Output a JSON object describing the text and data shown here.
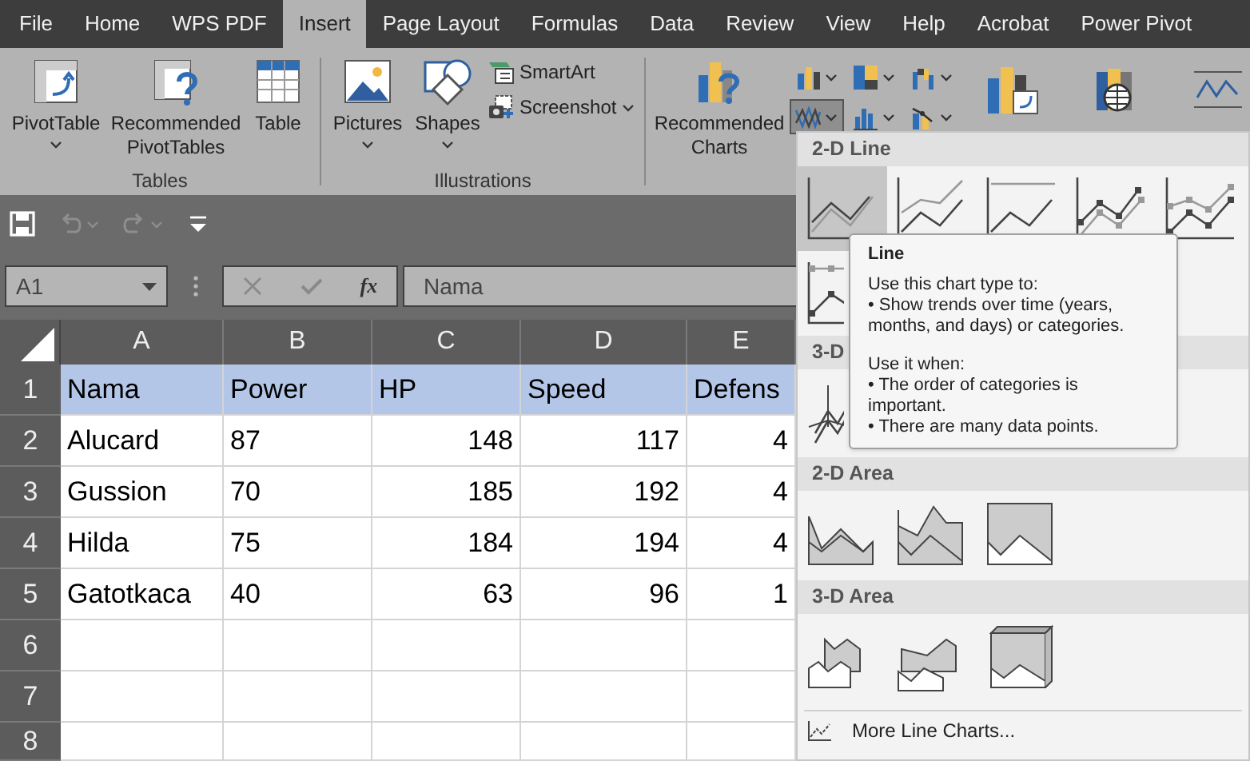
{
  "tabs": [
    {
      "label": "File",
      "selected": false
    },
    {
      "label": "Home",
      "selected": false
    },
    {
      "label": "WPS PDF",
      "selected": false
    },
    {
      "label": "Insert",
      "selected": true
    },
    {
      "label": "Page Layout",
      "selected": false
    },
    {
      "label": "Formulas",
      "selected": false
    },
    {
      "label": "Data",
      "selected": false
    },
    {
      "label": "Review",
      "selected": false
    },
    {
      "label": "View",
      "selected": false
    },
    {
      "label": "Help",
      "selected": false
    },
    {
      "label": "Acrobat",
      "selected": false
    },
    {
      "label": "Power Pivot",
      "selected": false
    }
  ],
  "ribbon": {
    "tables": {
      "label": "Tables",
      "buttons": [
        {
          "label": "PivotTable",
          "dropdown": true
        },
        {
          "label": "Recommended PivotTables",
          "dropdown": false
        },
        {
          "label": "Table",
          "dropdown": false
        }
      ]
    },
    "illustrations": {
      "label": "Illustrations",
      "large_buttons": [
        {
          "label": "Pictures",
          "dropdown": true
        },
        {
          "label": "Shapes",
          "dropdown": true
        }
      ],
      "small_buttons": [
        {
          "label": "SmartArt",
          "dropdown": false
        },
        {
          "label": "Screenshot",
          "dropdown": true
        }
      ]
    },
    "charts": {
      "recommended": {
        "label": "Recommended Charts"
      },
      "chart_types": [
        {
          "selected": false
        },
        {
          "selected": false
        },
        {
          "selected": false
        },
        {
          "selected": true
        },
        {
          "selected": false
        },
        {
          "selected": false
        }
      ]
    }
  },
  "quick_access": [
    {
      "kind": "save",
      "disabled": false
    },
    {
      "kind": "undo",
      "disabled": true
    },
    {
      "kind": "redo",
      "disabled": true
    },
    {
      "kind": "customize",
      "disabled": false
    }
  ],
  "name_box": {
    "value": "A1"
  },
  "formula_buttons": [
    {
      "kind": "cancel",
      "disabled": true
    },
    {
      "kind": "enter",
      "disabled": true
    },
    {
      "kind": "function",
      "disabled": false,
      "label": "fx"
    }
  ],
  "formula_bar": {
    "value": "Nama"
  },
  "sheet": {
    "columns": [
      {
        "label": "A",
        "align_right": false
      },
      {
        "label": "B",
        "align_right": false
      },
      {
        "label": "C",
        "align_right": true
      },
      {
        "label": "D",
        "align_right": true
      },
      {
        "label": "E",
        "align_right": true
      }
    ],
    "rows": [
      {
        "number": "1",
        "header": true,
        "cells": [
          "Nama",
          "Power",
          "HP",
          "Speed",
          "Defens"
        ]
      },
      {
        "number": "2",
        "header": false,
        "cells": [
          "Alucard",
          "87",
          "148",
          "117",
          "4"
        ]
      },
      {
        "number": "3",
        "header": false,
        "cells": [
          "Gussion",
          "70",
          "185",
          "192",
          "4"
        ]
      },
      {
        "number": "4",
        "header": false,
        "cells": [
          "Hilda",
          "75",
          "184",
          "194",
          "4"
        ]
      },
      {
        "number": "5",
        "header": false,
        "cells": [
          "Gatotkaca",
          "40",
          "63",
          "96",
          "1"
        ]
      },
      {
        "number": "6",
        "header": false
      },
      {
        "number": "7",
        "header": false
      },
      {
        "number": "8",
        "header": false
      }
    ]
  },
  "chart_menu": {
    "sections": [
      {
        "title": "2-D Line",
        "kind": "line2d",
        "options": [
          {
            "selected": true
          },
          {
            "selected": false
          },
          {
            "selected": false
          },
          {
            "selected": false
          },
          {
            "selected": false
          },
          {
            "selected": false
          }
        ]
      },
      {
        "title": "3-D",
        "kind": "line3d",
        "options": [
          {
            "selected": false
          }
        ]
      },
      {
        "title": "2-D Area",
        "kind": "area2d",
        "options": [
          {
            "selected": false
          },
          {
            "selected": false
          },
          {
            "selected": false
          }
        ]
      },
      {
        "title": "3-D Area",
        "kind": "area3d",
        "options": [
          {
            "selected": false
          },
          {
            "selected": false
          },
          {
            "selected": false
          }
        ]
      }
    ],
    "more": {
      "label": "More Line Charts..."
    }
  },
  "tooltip": {
    "title": "Line",
    "blocks": [
      {
        "heading": "Use this chart type to:",
        "bullets": [
          "• Show trends over time (years, months, and days) or categories."
        ]
      },
      {
        "heading": "Use it when:",
        "bullets": [
          "• The order of categories is important.",
          "• There are many data points."
        ]
      }
    ]
  }
}
